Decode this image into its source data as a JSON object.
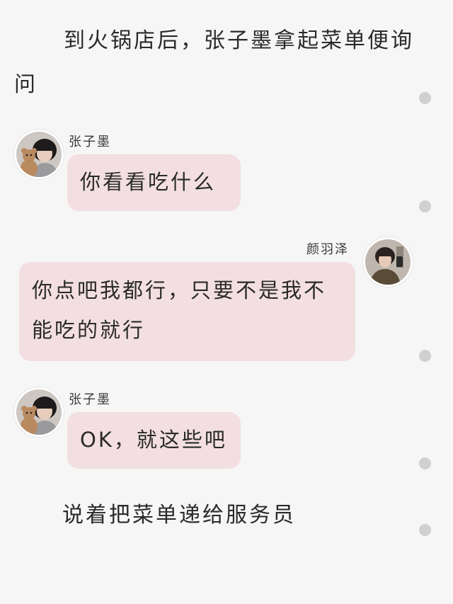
{
  "narration": [
    "到火锅店后，张子墨拿起菜单便询问",
    "说着把菜单递给服务员"
  ],
  "messages": [
    {
      "sender": "张子墨",
      "side": "left",
      "text": "你看看吃什么",
      "avatar": "avatar-boy-with-teddy-bear"
    },
    {
      "sender": "颜羽泽",
      "side": "right",
      "text": "你点吧我都行，只要不是我不能吃的就行",
      "avatar": "avatar-boy-mirror-selfie"
    },
    {
      "sender": "张子墨",
      "side": "left",
      "text": "OK，就这些吧",
      "avatar": "avatar-boy-with-teddy-bear"
    }
  ],
  "colors": {
    "background": "#f6f6f6",
    "bubble": "#f3dfe1",
    "scroll_dot": "#d0d0d0"
  }
}
